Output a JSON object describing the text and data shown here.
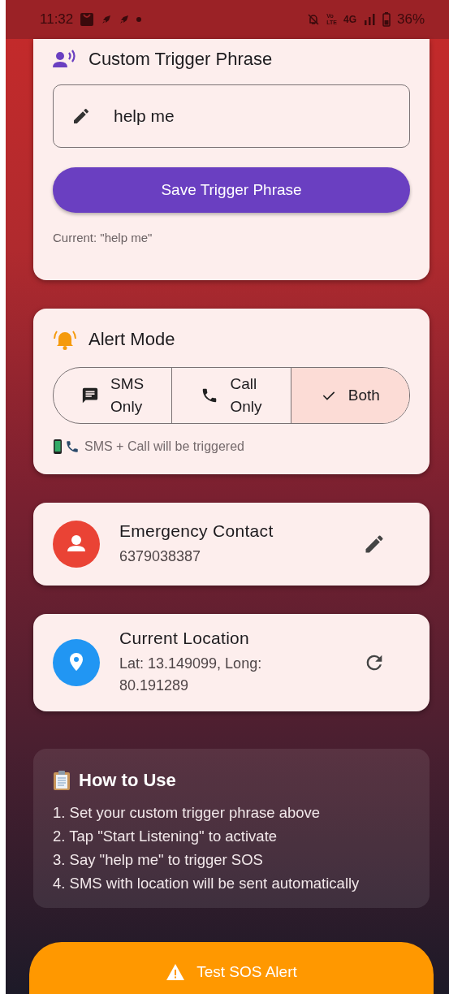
{
  "status_bar": {
    "time": "11:32",
    "volte_top": "Vo",
    "volte_bottom": "LTE",
    "network": "4G",
    "battery": "36%"
  },
  "trigger_card": {
    "title": "Custom Trigger Phrase",
    "input_value": "help me",
    "save_button": "Save Trigger Phrase",
    "current": "Current: \"help me\""
  },
  "alert_card": {
    "title": "Alert Mode",
    "modes": [
      {
        "kind": "sms",
        "label": "SMS Only",
        "selected": false
      },
      {
        "kind": "call",
        "label": "Call Only",
        "selected": false
      },
      {
        "kind": "both",
        "label": "Both",
        "selected": true
      }
    ],
    "hint": "SMS + Call will be triggered"
  },
  "contact_card": {
    "title": "Emergency Contact",
    "value": "6379038387"
  },
  "location_card": {
    "title": "Current Location",
    "value": "Lat: 13.149099, Long: 80.191289"
  },
  "how_to": {
    "title": "How to Use",
    "steps": [
      "1. Set your custom trigger phrase above",
      "2. Tap \"Start Listening\" to activate",
      "3. Say \"help me\" to trigger SOS",
      "4. SMS with location will be sent automatically"
    ]
  },
  "test_button": "Test SOS Alert"
}
